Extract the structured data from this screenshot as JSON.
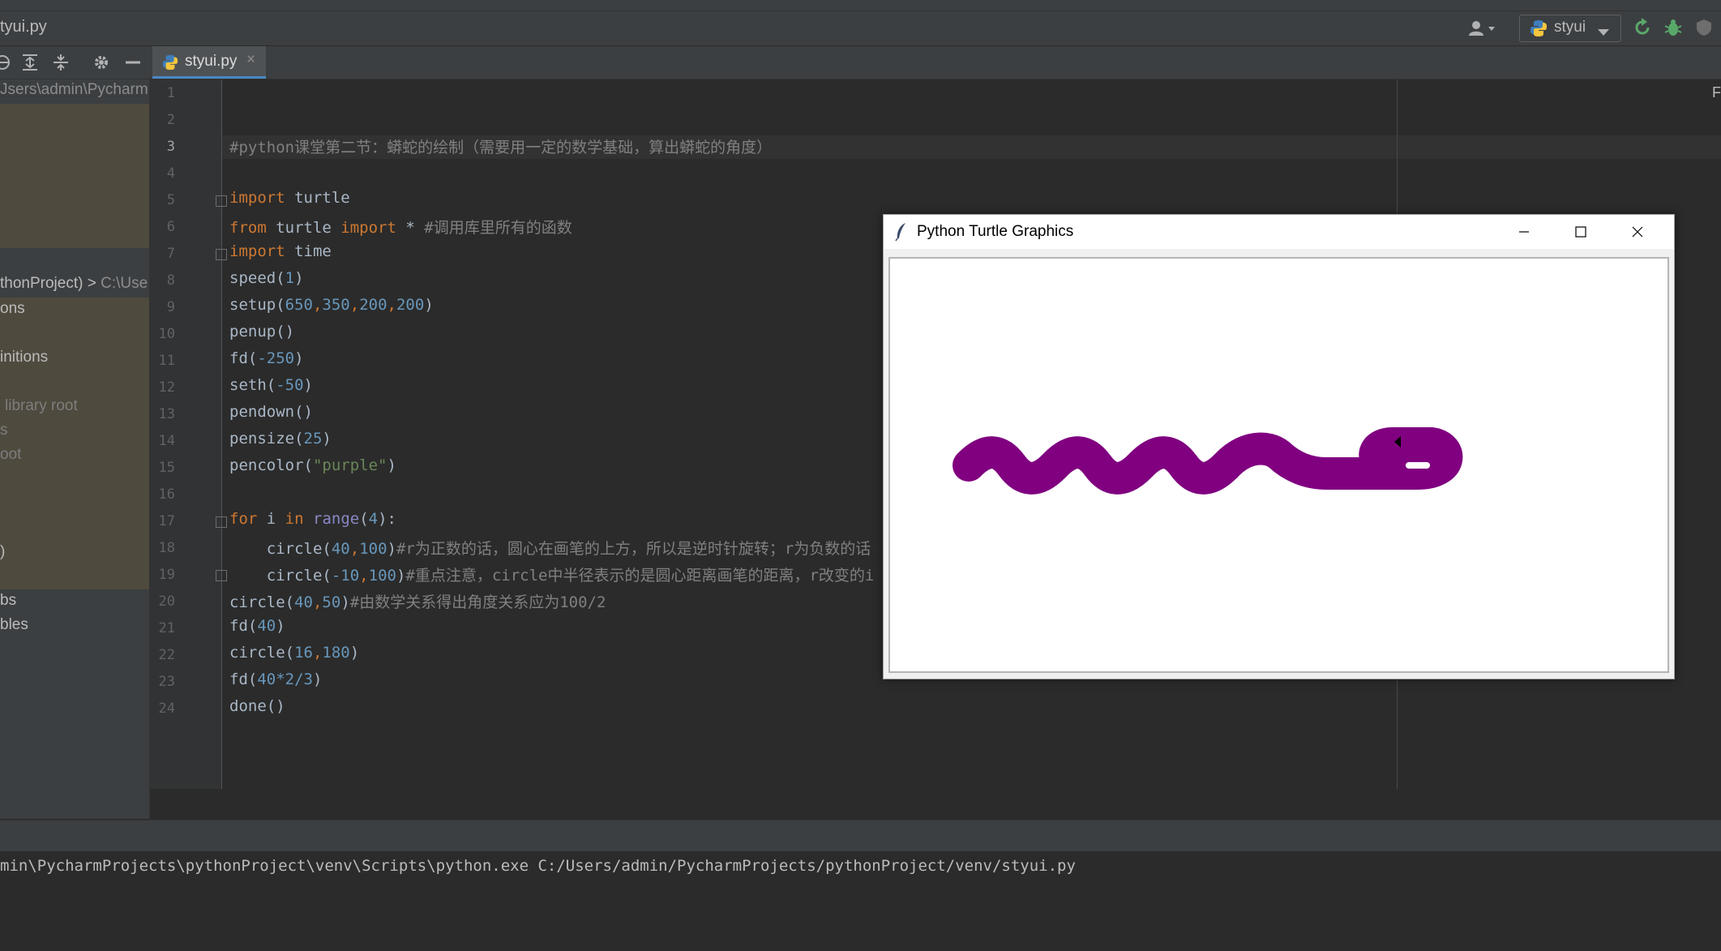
{
  "title_bar": {
    "file": "tyui.py",
    "run_config": "styui"
  },
  "editor": {
    "tab_label": "styui.py",
    "tab_close": "×",
    "right_marker": "F",
    "lines": [
      {
        "num": "1"
      },
      {
        "num": "2"
      },
      {
        "num": "3"
      },
      {
        "num": "4"
      },
      {
        "num": "5"
      },
      {
        "num": "6"
      },
      {
        "num": "7"
      },
      {
        "num": "8"
      },
      {
        "num": "9"
      },
      {
        "num": "10"
      },
      {
        "num": "11"
      },
      {
        "num": "12"
      },
      {
        "num": "13"
      },
      {
        "num": "14"
      },
      {
        "num": "15"
      },
      {
        "num": "16"
      },
      {
        "num": "17"
      },
      {
        "num": "18"
      },
      {
        "num": "19"
      },
      {
        "num": "20"
      },
      {
        "num": "21"
      },
      {
        "num": "22"
      },
      {
        "num": "23"
      },
      {
        "num": "24"
      }
    ],
    "code": {
      "l3": "#python课堂第二节：蟒蛇的绘制（需要用一定的数学基础，算出蟒蛇的角度）",
      "l5_kw": "import",
      "l5_rest": " turtle",
      "l6_kw1": "from",
      "l6_mid": " turtle ",
      "l6_kw2": "import",
      "l6_star": " * ",
      "l6_cmt": "#调用库里所有的函数",
      "l7_kw": "import",
      "l7_rest": " time",
      "l8_a": "speed(",
      "l8_n": "1",
      "l8_b": ")",
      "l9_a": "setup(",
      "l9_n1": "650",
      "l9_c1": ",",
      "l9_n2": "350",
      "l9_c2": ",",
      "l9_n3": "200",
      "l9_c3": ",",
      "l9_n4": "200",
      "l9_b": ")",
      "l10": "penup()",
      "l11_a": "fd(",
      "l11_n": "-250",
      "l11_b": ")",
      "l12_a": "seth(",
      "l12_n": "-50",
      "l12_b": ")",
      "l13": "pendown()",
      "l14_a": "pensize(",
      "l14_n": "25",
      "l14_b": ")",
      "l15_a": "pencolor(",
      "l15_s": "\"purple\"",
      "l15_b": ")",
      "l17_kw1": "for",
      "l17_mid": " i ",
      "l17_kw2": "in",
      "l17_sp": " ",
      "l17_kw3": "range",
      "l17_a": "(",
      "l17_n": "4",
      "l17_b": "):",
      "l18_a": "    circle(",
      "l18_n1": "40",
      "l18_c": ",",
      "l18_n2": "100",
      "l18_b": ")",
      "l18_cmt": "#r为正数的话，圆心在画笔的上方，所以是逆时针旋转；r为负数的话",
      "l19_a": "    circle(",
      "l19_n1": "-10",
      "l19_c": ",",
      "l19_n2": "100",
      "l19_b": ")",
      "l19_cmt": "#重点注意，circle中半径表示的是圆心距离画笔的距离，r改变的i",
      "l20_a": "circle(",
      "l20_n1": "40",
      "l20_c": ",",
      "l20_n2": "50",
      "l20_b": ")",
      "l20_cmt": "#由数学关系得出角度关系应为100/2",
      "l21_a": "fd(",
      "l21_n": "40",
      "l21_b": ")",
      "l22_a": "circle(",
      "l22_n1": "16",
      "l22_c": ",",
      "l22_n2": "180",
      "l22_b": ")",
      "l23_a": "fd(",
      "l23_n": "40*2/3",
      "l23_b": ")",
      "l24": "done()"
    }
  },
  "project": {
    "path": "Jsers\\admin\\Pycharm",
    "node": "thonProject) > ",
    "node_path": "C:\\Use",
    "rows": [
      "ons",
      "initions",
      "library root",
      "s",
      "oot",
      ")",
      "bs",
      "bles"
    ]
  },
  "run": {
    "command": "min\\PycharmProjects\\pythonProject\\venv\\Scripts\\python.exe C:/Users/admin/PycharmProjects/pythonProject/venv/styui.py"
  },
  "turtle_window": {
    "title": "Python Turtle Graphics",
    "pen_color": "#800080"
  },
  "colors": {
    "ide_background": "#2b2b2b",
    "keyword": "#cc7832",
    "number": "#6897bb",
    "string": "#6a8759",
    "comment": "#808080"
  }
}
